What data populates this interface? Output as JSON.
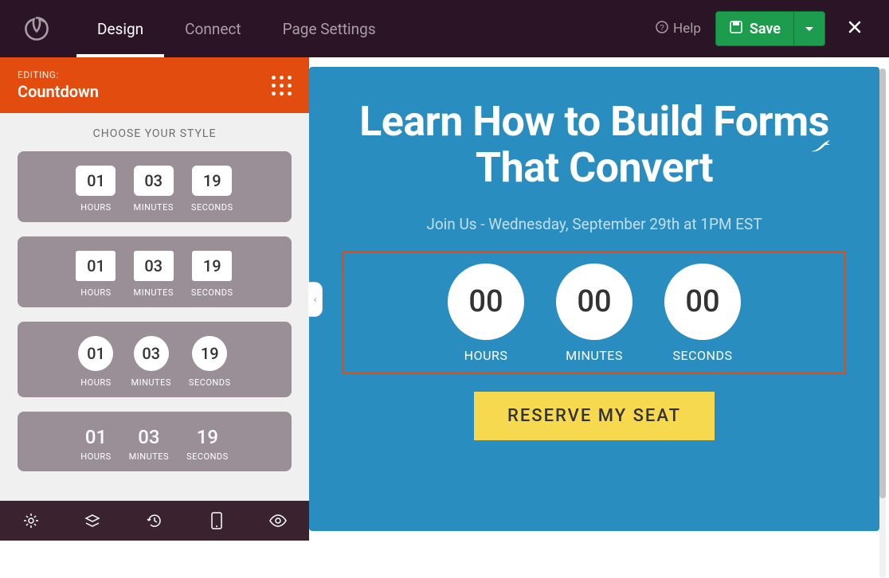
{
  "topbar": {
    "tabs": [
      "Design",
      "Connect",
      "Page Settings"
    ],
    "help_label": "Help",
    "save_label": "Save"
  },
  "panel": {
    "editing_label": "EDITING:",
    "editing_what": "Countdown",
    "choose_label": "CHOOSE YOUR STYLE"
  },
  "styles": [
    {
      "hours": "01",
      "minutes": "03",
      "seconds": "19",
      "labels": {
        "h": "HOURS",
        "m": "MINUTES",
        "s": "SECONDS"
      }
    },
    {
      "hours": "01",
      "minutes": "03",
      "seconds": "19",
      "labels": {
        "h": "HOURS",
        "m": "MINUTES",
        "s": "SECONDS"
      }
    },
    {
      "hours": "01",
      "minutes": "03",
      "seconds": "19",
      "labels": {
        "h": "HOURS",
        "m": "MINUTES",
        "s": "SECONDS"
      }
    },
    {
      "hours": "01",
      "minutes": "03",
      "seconds": "19",
      "labels": {
        "h": "HOURS",
        "m": "MINUTES",
        "s": "SECONDS"
      }
    }
  ],
  "canvas": {
    "headline": "Learn How to Build Forms That Convert",
    "subline": "Join Us - Wednesday, September 29th at 1PM EST",
    "countdown": {
      "hours": "00",
      "minutes": "00",
      "seconds": "00",
      "labels": {
        "h": "HOURS",
        "m": "MINUTES",
        "s": "SECONDS"
      }
    },
    "cta_label": "RESERVE MY SEAT"
  }
}
